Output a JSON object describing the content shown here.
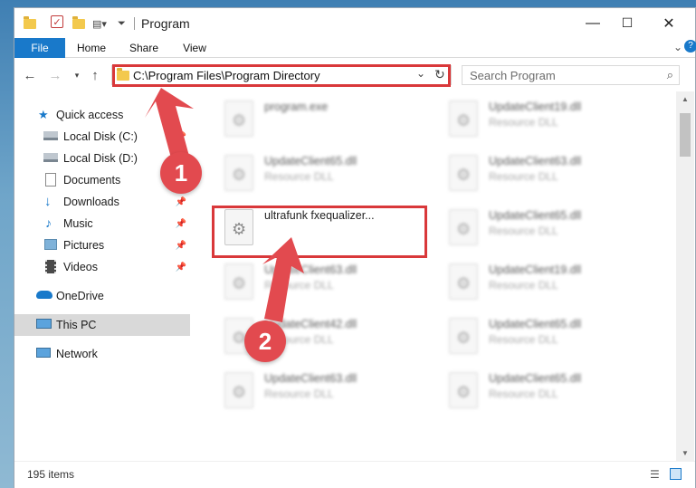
{
  "window": {
    "title": "Program",
    "buttons": {
      "minimize": "—",
      "maximize": "☐",
      "close": "✕"
    }
  },
  "ribbon": {
    "tabs": [
      "File",
      "Home",
      "Share",
      "View"
    ]
  },
  "address": {
    "path": "C:\\Program Files\\Program Directory",
    "search_placeholder": "Search Program"
  },
  "nav": {
    "items": [
      {
        "label": "Quick access",
        "icon": "star-icon"
      },
      {
        "label": "Local Disk (C:)",
        "icon": "drive-icon",
        "pinned": true
      },
      {
        "label": "Local Disk (D:)",
        "icon": "drive-icon",
        "pinned": true
      },
      {
        "label": "Documents",
        "icon": "documents-icon",
        "pinned": true
      },
      {
        "label": "Downloads",
        "icon": "downloads-icon",
        "pinned": true
      },
      {
        "label": "Music",
        "icon": "music-icon",
        "pinned": true
      },
      {
        "label": "Pictures",
        "icon": "pictures-icon",
        "pinned": true
      },
      {
        "label": "Videos",
        "icon": "videos-icon",
        "pinned": true
      },
      {
        "label": "OneDrive",
        "icon": "cloud-icon"
      },
      {
        "label": "This PC",
        "icon": "computer-icon",
        "selected": true
      },
      {
        "label": "Network",
        "icon": "network-icon"
      }
    ]
  },
  "files": {
    "left": [
      {
        "name": "program.exe",
        "type": ""
      },
      {
        "name": "UpdateClient65.dll",
        "type": "Resource DLL"
      },
      {
        "name": "ultrafunk fxequalizer...",
        "type": "",
        "highlighted": true
      },
      {
        "name": "UpdateClient63.dll",
        "type": "Resource DLL"
      },
      {
        "name": "UpdateClient42.dll",
        "type": "Resource DLL"
      },
      {
        "name": "UpdateClient63.dll",
        "type": "Resource DLL"
      }
    ],
    "right": [
      {
        "name": "UpdateClient19.dll",
        "type": "Resource DLL"
      },
      {
        "name": "UpdateClient63.dll",
        "type": "Resource DLL"
      },
      {
        "name": "UpdateClient65.dll",
        "type": "Resource DLL"
      },
      {
        "name": "UpdateClient19.dll",
        "type": "Resource DLL"
      },
      {
        "name": "UpdateClient65.dll",
        "type": "Resource DLL"
      },
      {
        "name": "UpdateClient65.dll",
        "type": "Resource DLL"
      }
    ]
  },
  "status": {
    "items": "195 items"
  },
  "annotations": {
    "step1": "1",
    "step2": "2"
  },
  "colors": {
    "accent": "#1979ca",
    "highlight": "#d9383a",
    "badge": "#e24a4f"
  }
}
